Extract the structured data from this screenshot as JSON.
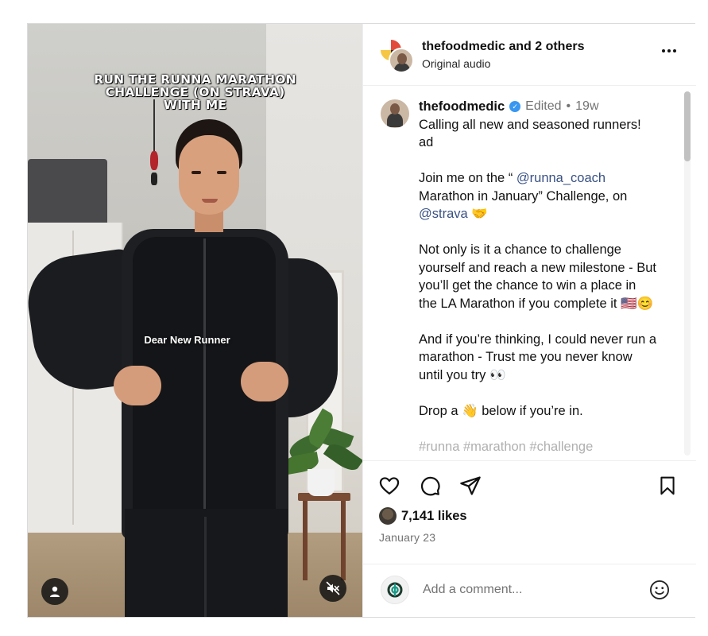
{
  "media": {
    "overlay_title": "RUN THE RUNNA MARATHON\nCHALLENGE (ON STRAVA)\nWITH ME",
    "overlay_subtitle": "Dear New Runner",
    "user_icon": "user-icon",
    "mute_icon": "muted-speaker-icon"
  },
  "header": {
    "username": "thefoodmedic",
    "others": "and 2 others",
    "audio": "Original audio",
    "more_icon": "•••"
  },
  "caption": {
    "username": "thefoodmedic",
    "edited": "Edited",
    "dot": "•",
    "age": "19w",
    "line1": "Calling all new and seasoned runners! ad",
    "p2_pre": "Join me on the “ ",
    "p2_mention1": "@runna_coach",
    "p2_mid": " Marathon in January” Challenge, on ",
    "p2_mention2": "@strava",
    "p2_emoji": " 🤝",
    "p3": "Not only is it a chance to challenge yourself and reach a new milestone -  But you’ll get the chance to win a place in the LA Marathon if you complete it 🇺🇸😊",
    "p4": "And if you’re thinking, I could never run a marathon - Trust me you never know until you try 👀",
    "p5": "Drop a 👋 below if you’re in.",
    "p6_cut": "#runna  #marathon  #challenge"
  },
  "actions": {
    "likes": "7,141 likes",
    "date": "January 23"
  },
  "comment": {
    "placeholder": "Add a comment..."
  },
  "colors": {
    "mention": "#385185",
    "verified": "#3897f0",
    "muted_text": "#737373"
  }
}
